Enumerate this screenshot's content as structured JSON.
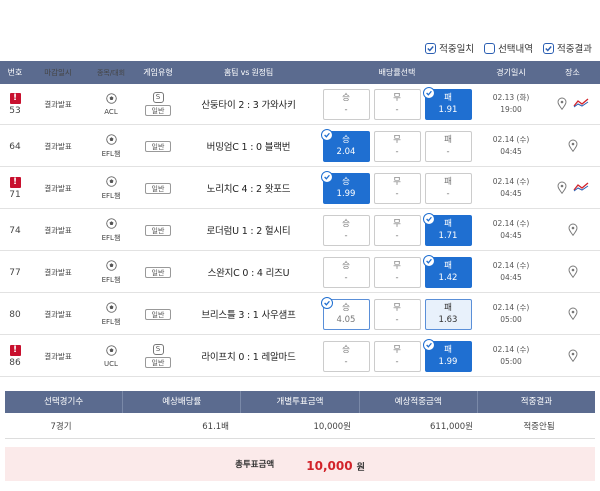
{
  "legend": [
    {
      "label": "적중일치",
      "checked": true
    },
    {
      "label": "선택내역",
      "checked": false
    },
    {
      "label": "적중결과",
      "checked": true
    }
  ],
  "header": {
    "no": "번호",
    "deadline": "마감일시",
    "league": "종목/대회",
    "gametype": "게임유형",
    "match": "홈팀 vs 원정팀",
    "odds": "배당률선택",
    "date": "경기일시",
    "place": "장소"
  },
  "rows": [
    {
      "warn": true,
      "no": "53",
      "deadline": "결과발표",
      "league": "ACL",
      "special": true,
      "gametype": "일반",
      "match": "산둥타이 2 : 3 가와사키",
      "odds": [
        {
          "label": "승",
          "value": "-",
          "state": ""
        },
        {
          "label": "무",
          "value": "-",
          "state": ""
        },
        {
          "label": "패",
          "value": "1.91",
          "state": "sel"
        }
      ],
      "check": 2,
      "date": "02.13 (화)",
      "time": "19:00",
      "trend": true
    },
    {
      "warn": false,
      "no": "64",
      "deadline": "결과발표",
      "league": "EFL챔",
      "special": false,
      "gametype": "일반",
      "match": "버밍엄C 1 : 0 블랙번",
      "odds": [
        {
          "label": "승",
          "value": "2.04",
          "state": "sel"
        },
        {
          "label": "무",
          "value": "-",
          "state": ""
        },
        {
          "label": "패",
          "value": "-",
          "state": ""
        }
      ],
      "check": 0,
      "date": "02.14 (수)",
      "time": "04:45",
      "trend": false
    },
    {
      "warn": true,
      "no": "71",
      "deadline": "결과발표",
      "league": "EFL챔",
      "special": false,
      "gametype": "일반",
      "match": "노리치C 4 : 2 왓포드",
      "odds": [
        {
          "label": "승",
          "value": "1.99",
          "state": "sel"
        },
        {
          "label": "무",
          "value": "-",
          "state": ""
        },
        {
          "label": "패",
          "value": "-",
          "state": ""
        }
      ],
      "check": 0,
      "date": "02.14 (수)",
      "time": "04:45",
      "trend": true
    },
    {
      "warn": false,
      "no": "74",
      "deadline": "결과발표",
      "league": "EFL챔",
      "special": false,
      "gametype": "일반",
      "match": "로더럼U 1 : 2 헐시티",
      "odds": [
        {
          "label": "승",
          "value": "-",
          "state": ""
        },
        {
          "label": "무",
          "value": "-",
          "state": ""
        },
        {
          "label": "패",
          "value": "1.71",
          "state": "sel"
        }
      ],
      "check": 2,
      "date": "02.14 (수)",
      "time": "04:45",
      "trend": false
    },
    {
      "warn": false,
      "no": "77",
      "deadline": "결과발표",
      "league": "EFL챔",
      "special": false,
      "gametype": "일반",
      "match": "스완지C 0 : 4 리즈U",
      "odds": [
        {
          "label": "승",
          "value": "-",
          "state": ""
        },
        {
          "label": "무",
          "value": "-",
          "state": ""
        },
        {
          "label": "패",
          "value": "1.42",
          "state": "sel"
        }
      ],
      "check": 2,
      "date": "02.14 (수)",
      "time": "04:45",
      "trend": false
    },
    {
      "warn": false,
      "no": "80",
      "deadline": "결과발표",
      "league": "EFL챔",
      "special": false,
      "gametype": "일반",
      "match": "브리스틀 3 : 1 사우샘프",
      "odds": [
        {
          "label": "승",
          "value": "4.05",
          "state": "hit"
        },
        {
          "label": "무",
          "value": "-",
          "state": ""
        },
        {
          "label": "패",
          "value": "1.63",
          "state": "win"
        }
      ],
      "check": 0,
      "date": "02.14 (수)",
      "time": "05:00",
      "trend": false
    },
    {
      "warn": true,
      "no": "86",
      "deadline": "결과발표",
      "league": "UCL",
      "special": true,
      "gametype": "일반",
      "match": "라이프치 0 : 1 레알마드",
      "odds": [
        {
          "label": "승",
          "value": "-",
          "state": ""
        },
        {
          "label": "무",
          "value": "-",
          "state": ""
        },
        {
          "label": "패",
          "value": "1.99",
          "state": "sel"
        }
      ],
      "check": 2,
      "date": "02.14 (수)",
      "time": "05:00",
      "trend": false
    }
  ],
  "summary": {
    "headers": [
      "선택경기수",
      "예상배당률",
      "개별투표금액",
      "예상적중금액",
      "적중결과"
    ],
    "values": [
      "7경기",
      "61.1배",
      "10,000원",
      "611,000원",
      "적중안됨"
    ]
  },
  "total": {
    "label": "총투표금액",
    "value": "10,000",
    "unit": "원"
  },
  "colors": {
    "header": "#5b6b8f",
    "selected": "#1f6fd1",
    "warn": "#c8102e",
    "total_bg": "#fbeaea",
    "total_value": "#d2232a"
  }
}
